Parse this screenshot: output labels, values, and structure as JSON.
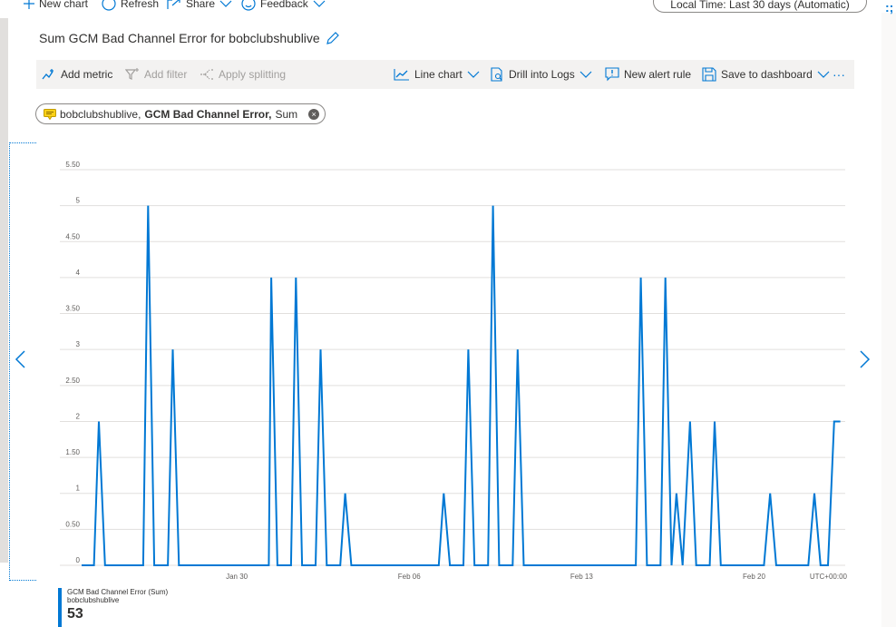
{
  "toolbar_top": {
    "new_chart": "New chart",
    "refresh": "Refresh",
    "share": "Share",
    "feedback": "Feedback",
    "time_range": "Local Time: Last 30 days (Automatic)"
  },
  "chart": {
    "title": "Sum GCM Bad Channel Error for bobclubshublive"
  },
  "toolbar": {
    "add_metric": "Add metric",
    "add_filter": "Add filter",
    "apply_splitting": "Apply splitting",
    "line_chart": "Line chart",
    "drill_into_logs": "Drill into Logs",
    "new_alert_rule": "New alert rule",
    "save_to_dashboard": "Save to dashboard",
    "more": "···"
  },
  "metric_pill": {
    "resource": "bobclubshublive,",
    "metric": "GCM Bad Channel Error,",
    "aggregation": "Sum"
  },
  "legend": {
    "series_label": "GCM Bad Channel Error (Sum)",
    "resource": "bobclubshublive",
    "total": "53"
  },
  "colors": {
    "accent": "#0078d4",
    "grid": "#e1dfdd"
  },
  "chart_data": {
    "type": "line",
    "timezone_label": "UTC+00:00",
    "ylim": [
      0,
      5.5
    ],
    "y_ticks": [
      "0",
      "0.50",
      "1",
      "1.50",
      "2",
      "2.50",
      "3",
      "3.50",
      "4",
      "4.50",
      "5",
      "5.50"
    ],
    "x_tick_labels": [
      "Jan 30",
      "Feb 06",
      "Feb 13",
      "Feb 20"
    ],
    "x_tick_days": [
      0,
      7,
      14,
      21
    ],
    "x_range_days": [
      -6.3,
      24.7
    ],
    "series": [
      {
        "name": "GCM Bad Channel Error (Sum)",
        "color": "#0078d4",
        "points": [
          [
            -6.3,
            0
          ],
          [
            -6.0,
            0
          ],
          [
            -5.8,
            0
          ],
          [
            -5.6,
            2
          ],
          [
            -5.35,
            0
          ],
          [
            -3.8,
            0
          ],
          [
            -3.6,
            5
          ],
          [
            -3.35,
            0
          ],
          [
            -2.8,
            0
          ],
          [
            -2.6,
            3
          ],
          [
            -2.35,
            0
          ],
          [
            -1.05,
            0
          ],
          [
            1.3,
            0
          ],
          [
            1.4,
            4
          ],
          [
            1.65,
            0
          ],
          [
            2.2,
            0
          ],
          [
            2.4,
            4
          ],
          [
            2.65,
            0
          ],
          [
            3.2,
            0
          ],
          [
            3.4,
            3
          ],
          [
            3.65,
            0
          ],
          [
            4.2,
            0
          ],
          [
            4.4,
            1
          ],
          [
            4.65,
            0
          ],
          [
            8.2,
            0
          ],
          [
            8.4,
            1
          ],
          [
            8.65,
            0
          ],
          [
            9.2,
            0
          ],
          [
            9.4,
            3
          ],
          [
            9.65,
            0
          ],
          [
            10.2,
            0
          ],
          [
            10.4,
            5
          ],
          [
            10.65,
            0
          ],
          [
            11.2,
            0
          ],
          [
            11.4,
            3
          ],
          [
            11.65,
            0
          ],
          [
            16.2,
            0
          ],
          [
            16.4,
            4
          ],
          [
            16.65,
            0
          ],
          [
            17.2,
            0
          ],
          [
            17.4,
            4
          ],
          [
            17.65,
            0
          ],
          [
            17.85,
            1
          ],
          [
            18.1,
            0
          ],
          [
            18.4,
            2
          ],
          [
            18.65,
            0
          ],
          [
            19.2,
            0
          ],
          [
            19.4,
            2
          ],
          [
            19.65,
            0
          ],
          [
            21.4,
            0
          ],
          [
            21.65,
            1
          ],
          [
            21.9,
            0
          ],
          [
            23.2,
            0
          ],
          [
            23.45,
            1
          ],
          [
            23.7,
            0
          ],
          [
            24.0,
            0
          ],
          [
            24.25,
            2
          ],
          [
            24.5,
            2
          ]
        ]
      }
    ]
  }
}
